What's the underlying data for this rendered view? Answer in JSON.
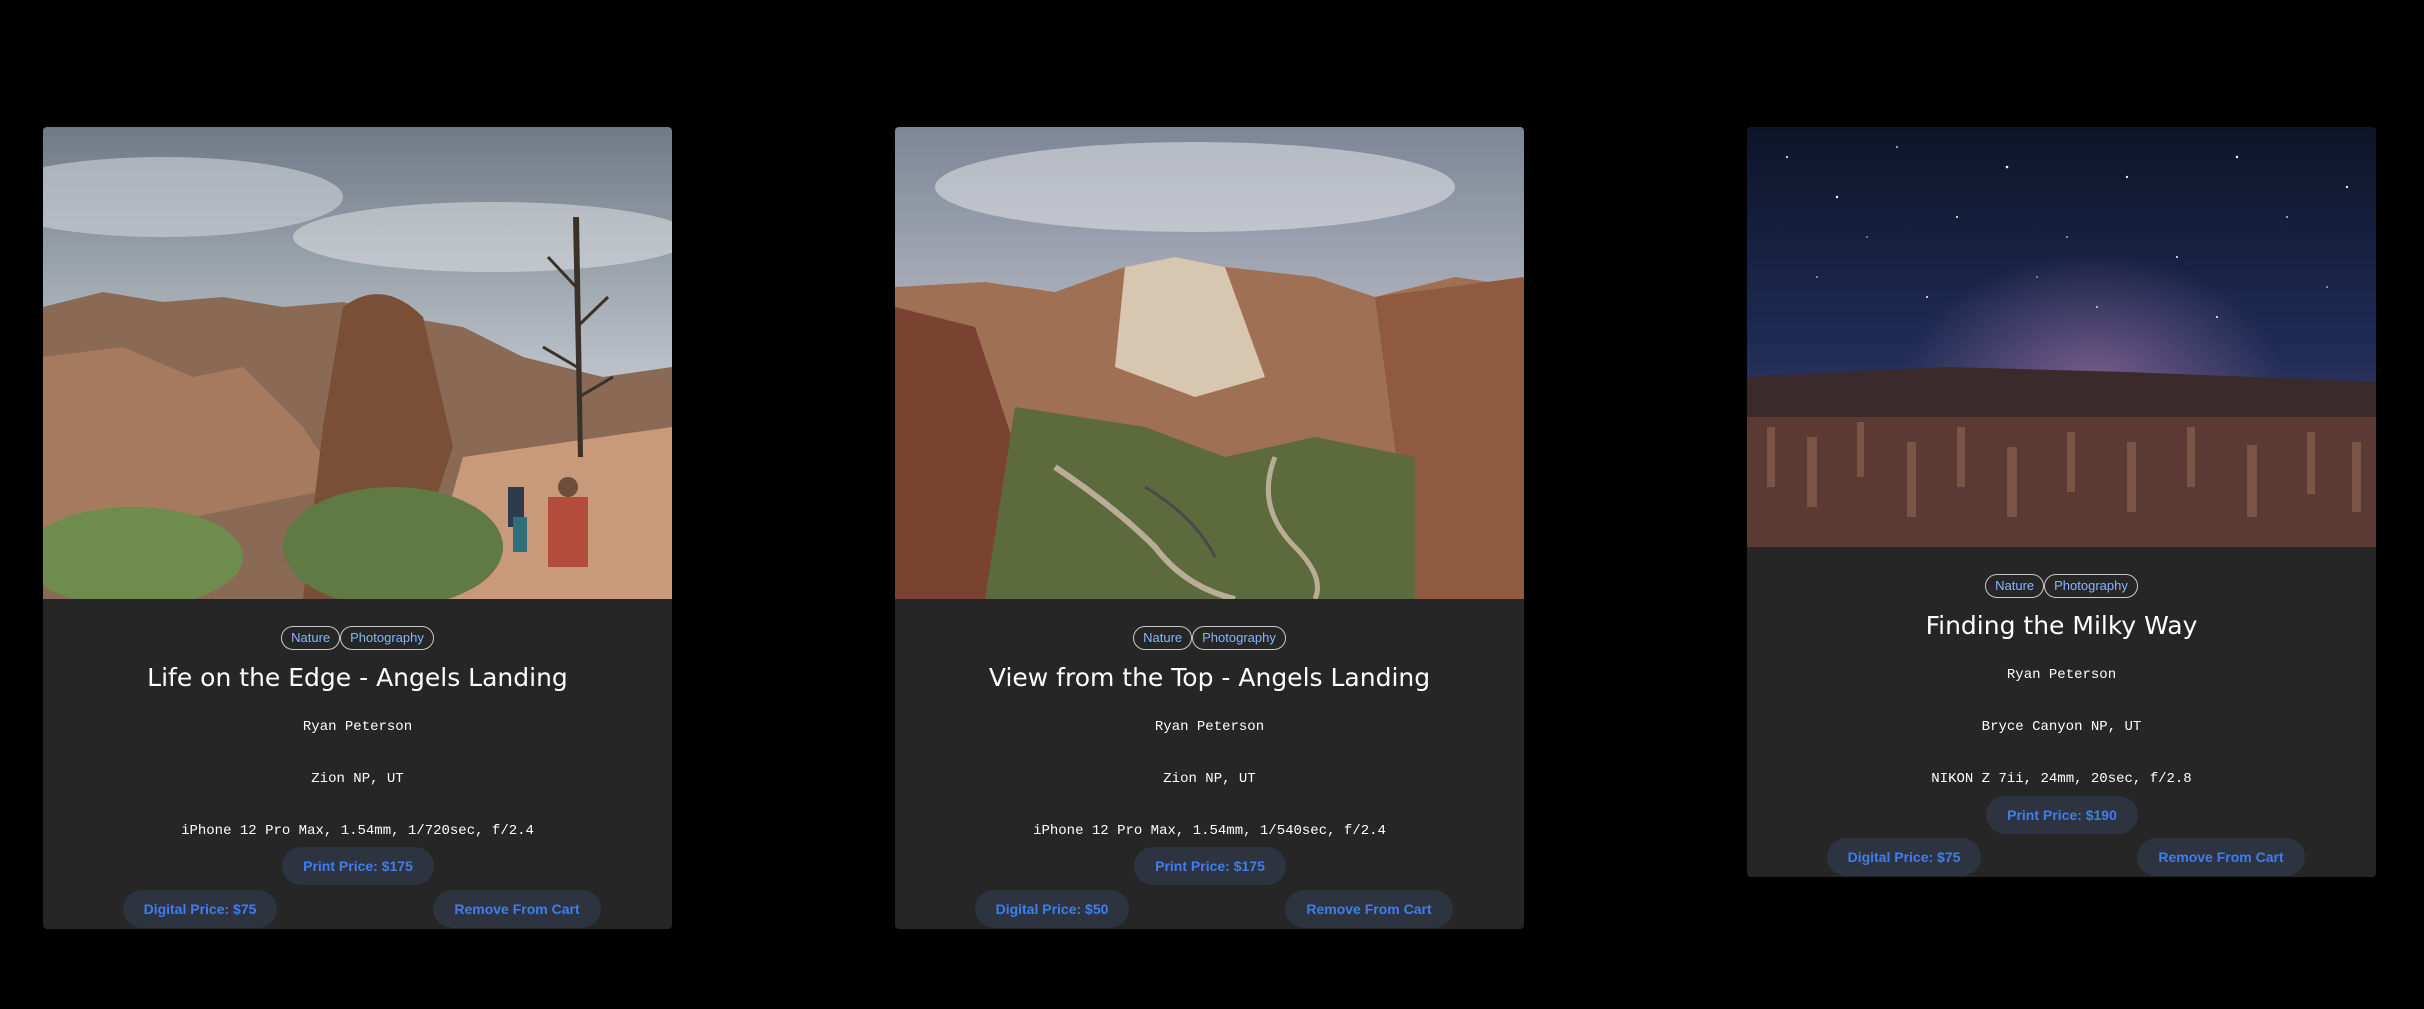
{
  "cards": [
    {
      "tags": [
        "Nature",
        "Photography"
      ],
      "title": "Life on the Edge - Angels Landing",
      "photographer": "Ryan Peterson",
      "location": "Zion NP, UT",
      "camera": "iPhone 12 Pro Max, 1.54mm, 1/720sec, f/2.4",
      "print_price": "Print Price: $175",
      "digital_price": "Digital Price: $75",
      "remove_label": "Remove From Cart"
    },
    {
      "tags": [
        "Nature",
        "Photography"
      ],
      "title": "View from the Top - Angels Landing",
      "photographer": "Ryan Peterson",
      "location": "Zion NP, UT",
      "camera": "iPhone 12 Pro Max, 1.54mm, 1/540sec, f/2.4",
      "print_price": "Print Price: $175",
      "digital_price": "Digital Price: $50",
      "remove_label": "Remove From Cart"
    },
    {
      "tags": [
        "Nature",
        "Photography"
      ],
      "title": "Finding the Milky Way",
      "photographer": "Ryan Peterson",
      "location": "Bryce Canyon NP, UT",
      "camera": "NIKON Z 7ii, 24mm, 20sec, f/2.8",
      "print_price": "Print Price: $190",
      "digital_price": "Digital Price: $75",
      "remove_label": "Remove From Cart"
    }
  ],
  "colors": {
    "background": "#000000",
    "card": "#262626",
    "button_bg": "#2d333f",
    "button_text": "#3e7ef0",
    "tag_text": "#8ab4f8"
  }
}
